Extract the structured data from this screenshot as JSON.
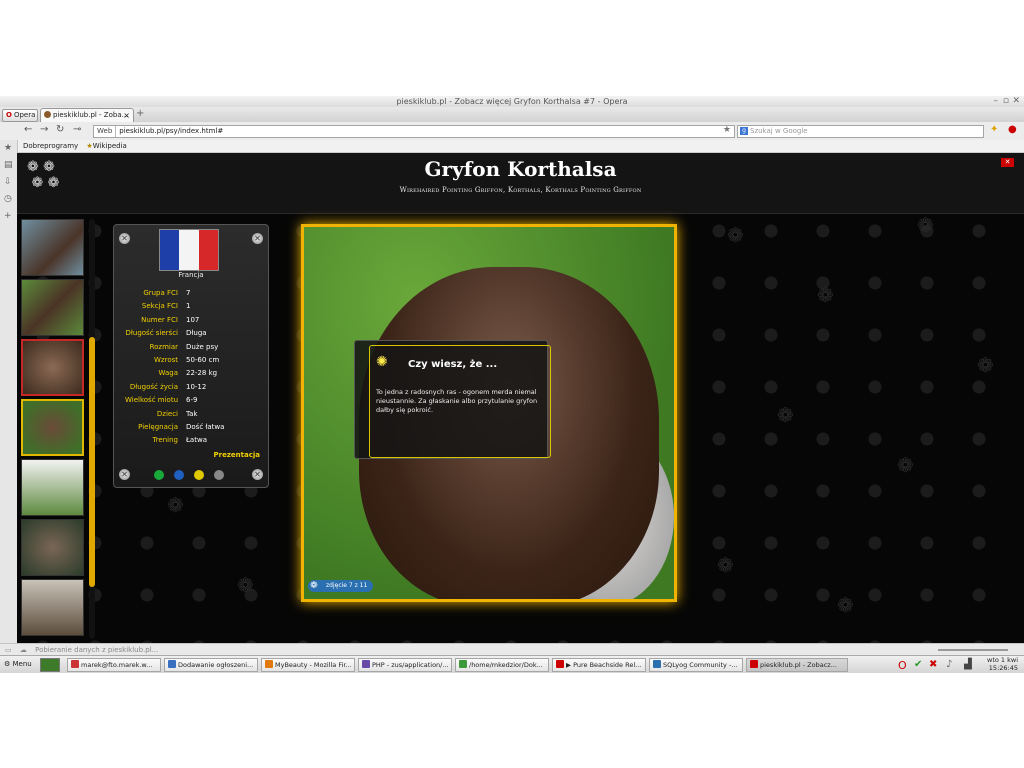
{
  "window": {
    "title": "pieskiklub.pl - Zobacz więcej Gryfon Korthalsa #7 - Opera",
    "controls": [
      "–",
      "▫",
      "✕"
    ]
  },
  "tabbar": {
    "menu_label": "Opera",
    "tab_label": "pieskiklub.pl - Zoba...",
    "new_tab": "+"
  },
  "navbar": {
    "mode_label": "Web",
    "url": "pieskiklub.pl/psy/index.html#",
    "search_placeholder": "Szukaj w Google"
  },
  "bookmarks": [
    {
      "label": "Dobreprogramy"
    },
    {
      "label": "Wikipedia"
    }
  ],
  "page": {
    "title": "Gryfon Korthalsa",
    "subtitle": "Wirehaired Pointing Griffon, Korthals, Korthals Pointing Griffon",
    "country": "Francja",
    "info_rows": [
      {
        "k": "Grupa FCI",
        "v": "7"
      },
      {
        "k": "Sekcja FCI",
        "v": "1"
      },
      {
        "k": "Numer FCI",
        "v": "107"
      },
      {
        "k": "Długość sierści",
        "v": "Długa"
      },
      {
        "k": "Rozmiar",
        "v": "Duże psy"
      },
      {
        "k": "Wzrost",
        "v": "50-60 cm"
      },
      {
        "k": "Waga",
        "v": "22-28 kg"
      },
      {
        "k": "Długość życia",
        "v": "10-12"
      },
      {
        "k": "Wielkość miotu",
        "v": "6-9"
      },
      {
        "k": "Dzieci",
        "v": "Tak"
      },
      {
        "k": "Pielęgnacja",
        "v": "Dość łatwa"
      },
      {
        "k": "Trening",
        "v": "Łatwa"
      }
    ],
    "presentation_label": "Prezentacja",
    "photo_counter": "zdjęcie 7 z 11",
    "tip_title": "Czy wiesz, że ...",
    "tip_body": "To jedna z radosnych ras - ogonem merda niemal nieustannie. Za głaskanie albo przytulanie gryfon dałby się pokroić."
  },
  "status_text": "Pobieranie danych z pieskiklub.pl...",
  "taskbar": {
    "menu_label": "Menu",
    "tasks": [
      "marek@fto.marek.w...",
      "Dodawanie ogłoszeni...",
      "MyBeauty - Mozilla Fir...",
      "PHP - zus/application/...",
      "/home/mkedzior/Dok...",
      "▶ Pure Beachside Rel...",
      "SQLyog Community -...",
      "pieskiklub.pl - Zobacz..."
    ],
    "clock_day": "wto 1 kwi",
    "clock_time": "15:26:45"
  },
  "colors": {
    "accent_yellow": "#f2d000",
    "frame_gold": "#f0b400",
    "flag_blue": "#1f3fa8",
    "flag_red": "#d62828"
  }
}
